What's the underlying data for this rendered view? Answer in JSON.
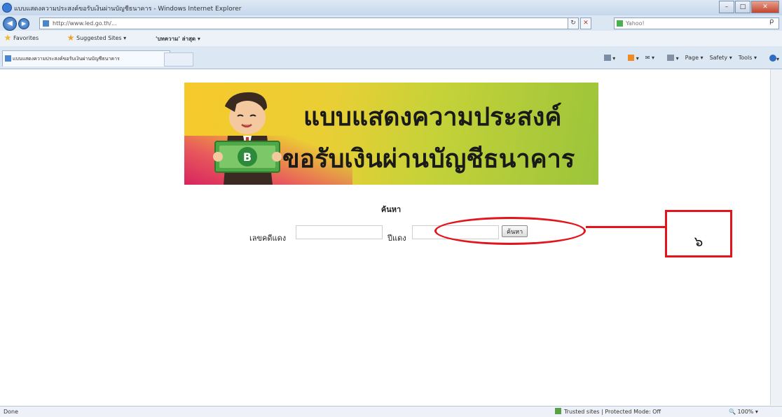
{
  "window": {
    "title": "แบบแสดงความประสงค์ขอรับเงินผ่านบัญชีธนาคาร - Windows Internet Explorer",
    "buttons": {
      "minimize": "–",
      "maximize": "□",
      "close": "✕"
    }
  },
  "navbar": {
    "back": "◀",
    "forward": "▶",
    "address": "http://www.led.go.th/...",
    "refresh": "↻",
    "stop": "✕",
    "search_placeholder": "Yahoo!",
    "search_button": "ρ"
  },
  "favbar": {
    "favorites": "Favorites",
    "suggested": "Suggested Sites ▾",
    "news": "'บทความ' ล่าสุด ▾"
  },
  "tab": {
    "title": "แบบแสดงความประสงค์ขอรับเงินผ่านบัญชีธนาคาร"
  },
  "cmdbar": {
    "page": "Page ▾",
    "safety": "Safety ▾",
    "tools": "Tools ▾"
  },
  "banner": {
    "line1": "แบบแสดงความประสงค์",
    "line2": "ขอรับเงินผ่านบัญชีธนาคาร",
    "coin_letter": "B"
  },
  "form": {
    "heading": "ค้นหา",
    "case_label": "เลขคดีแดง",
    "year_label": "ปีแดง",
    "search_button": "ค้นหา"
  },
  "annotation": {
    "label": "๖"
  },
  "statusbar": {
    "left": "Done",
    "zone": "Trusted sites | Protected Mode: Off",
    "zoom": "100%"
  },
  "colors": {
    "annotation": "#e3141b",
    "banner_yellow": "#f7c92b",
    "banner_green": "#9bc43b"
  }
}
